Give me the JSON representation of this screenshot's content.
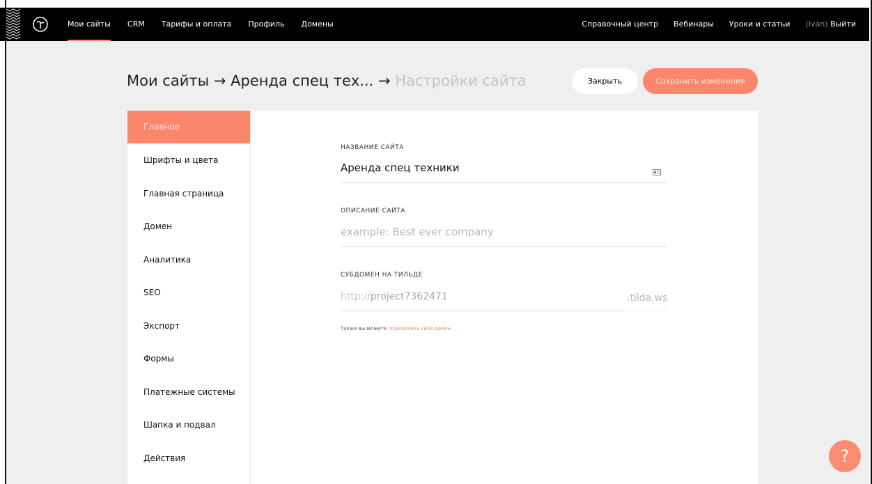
{
  "topbar": {
    "nav_left": [
      "Мои сайты",
      "CRM",
      "Тарифы и оплата",
      "Профиль",
      "Домены"
    ],
    "nav_right": [
      "Справочный центр",
      "Вебинары",
      "Уроки и статьи"
    ],
    "user": "(Ivan)",
    "logout": "Выйти"
  },
  "header": {
    "crumb_sites": "Мои сайты",
    "arrow1": "→",
    "crumb_project": "Аренда спец тех...",
    "arrow2": "→",
    "crumb_current": "Настройки сайта",
    "close_label": "Закрыть",
    "save_label": "Сохранить изменения"
  },
  "sidebar": {
    "items": [
      {
        "label": "Главное",
        "active": true
      },
      {
        "label": "Шрифты и цвета"
      },
      {
        "label": "Главная страница"
      },
      {
        "label": "Домен"
      },
      {
        "label": "Аналитика"
      },
      {
        "label": "SEO"
      },
      {
        "label": "Экспорт"
      },
      {
        "label": "Формы"
      },
      {
        "label": "Платежные системы"
      },
      {
        "label": "Шапка и подвал"
      },
      {
        "label": "Действия"
      }
    ]
  },
  "form": {
    "site_name_label": "НАЗВАНИЕ САЙТА",
    "site_name_value": "Аренда спец техники",
    "description_label": "ОПИСАНИЕ САЙТА",
    "description_placeholder": "example: Best ever company",
    "subdomain_label": "СУБДОМЕН НА ТИЛЬДЕ",
    "subdomain_prefix": "http://",
    "subdomain_value": "project7362471",
    "subdomain_suffix": ".tilda.ws",
    "hint_text": "Также вы можете",
    "hint_link": "подключить свой домен."
  },
  "help": {
    "label": "?"
  },
  "colors": {
    "accent": "#fa876b",
    "topbar": "#000000",
    "background": "#efefef"
  },
  "icons": [
    "pattern-icon",
    "tilda-logo-icon",
    "card-icon"
  ]
}
